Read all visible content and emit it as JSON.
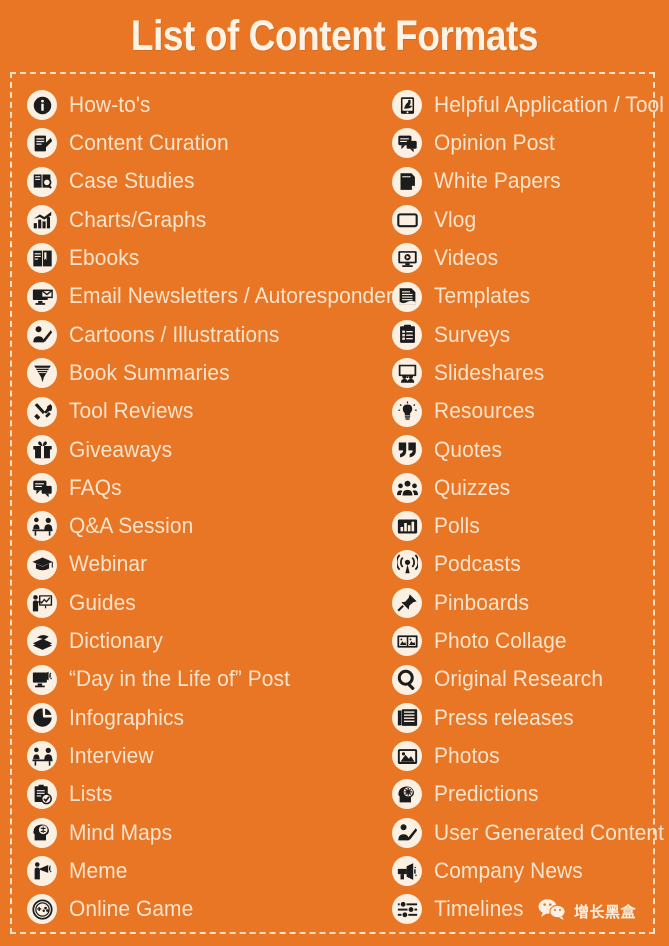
{
  "title": "List of Content Formats",
  "colors": {
    "background": "#E87625",
    "text": "#F6E4CE",
    "badge": "#FBF0E1",
    "icon": "#1C1C1C",
    "border": "#F7E2C9"
  },
  "left_column": [
    {
      "icon": "info-circle-icon",
      "label": "How-to's"
    },
    {
      "icon": "notepad-pencil-icon",
      "label": "Content Curation"
    },
    {
      "icon": "document-magnifier-icon",
      "label": "Case Studies"
    },
    {
      "icon": "bar-chart-arrow-icon",
      "label": "Charts/Graphs"
    },
    {
      "icon": "open-book-icon",
      "label": "Ebooks"
    },
    {
      "icon": "monitor-envelope-icon",
      "label": "Email Newsletters / Autoresponders"
    },
    {
      "icon": "person-drawing-icon",
      "label": "Cartoons / Illustrations"
    },
    {
      "icon": "book-ribbon-icon",
      "label": "Book Summaries"
    },
    {
      "icon": "tools-cross-icon",
      "label": "Tool Reviews"
    },
    {
      "icon": "gift-icon",
      "label": "Giveaways"
    },
    {
      "icon": "speech-bubbles-icon",
      "label": "FAQs"
    },
    {
      "icon": "two-people-table-icon",
      "label": "Q&A Session"
    },
    {
      "icon": "graduation-cap-icon",
      "label": "Webinar"
    },
    {
      "icon": "presenter-board-icon",
      "label": "Guides"
    },
    {
      "icon": "books-stack-icon",
      "label": "Dictionary"
    },
    {
      "icon": "monitor-megaphone-icon",
      "label": "“Day in the Life of” Post"
    },
    {
      "icon": "pie-chart-icon",
      "label": "Infographics"
    },
    {
      "icon": "two-people-table-icon",
      "label": "Interview"
    },
    {
      "icon": "checklist-clipboard-icon",
      "label": "Lists"
    },
    {
      "icon": "head-brain-icon",
      "label": "Mind Maps"
    },
    {
      "icon": "person-megaphone-icon",
      "label": "Meme"
    },
    {
      "icon": "game-controller-icon",
      "label": "Online Game"
    }
  ],
  "right_column": [
    {
      "icon": "tablet-hand-icon",
      "label": "Helpful Application / Tool"
    },
    {
      "icon": "speech-bubbles-icon",
      "label": "Opinion Post"
    },
    {
      "icon": "page-fold-icon",
      "label": "White Papers"
    },
    {
      "icon": "screen-icon",
      "label": "Vlog"
    },
    {
      "icon": "monitor-play-icon",
      "label": "Videos"
    },
    {
      "icon": "document-lines-icon",
      "label": "Templates"
    },
    {
      "icon": "clipboard-list-icon",
      "label": "Surveys"
    },
    {
      "icon": "presentation-people-icon",
      "label": "Slideshares"
    },
    {
      "icon": "lightbulb-icon",
      "label": "Resources"
    },
    {
      "icon": "quotation-mark-icon",
      "label": "Quotes"
    },
    {
      "icon": "people-group-icon",
      "label": "Quizzes"
    },
    {
      "icon": "bar-chart-icon",
      "label": "Polls"
    },
    {
      "icon": "podcast-signal-icon",
      "label": "Podcasts"
    },
    {
      "icon": "push-pin-icon",
      "label": "Pinboards"
    },
    {
      "icon": "photo-collage-icon",
      "label": "Photo Collage"
    },
    {
      "icon": "magnifier-icon",
      "label": "Original Research"
    },
    {
      "icon": "newspaper-icon",
      "label": "Press releases"
    },
    {
      "icon": "image-mountain-icon",
      "label": "Photos"
    },
    {
      "icon": "head-gear-icon",
      "label": "Predictions"
    },
    {
      "icon": "person-drawing-icon",
      "label": "User Generated Content"
    },
    {
      "icon": "megaphone-icon",
      "label": "Company News"
    },
    {
      "icon": "sliders-icon",
      "label": "Timelines"
    }
  ],
  "watermark": {
    "icon": "wechat-icon",
    "text": "增长黑盒"
  }
}
